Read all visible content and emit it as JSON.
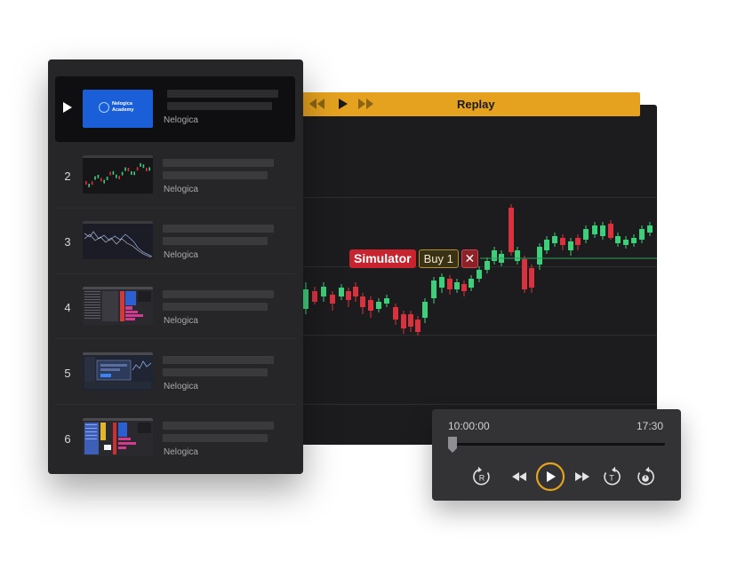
{
  "replay": {
    "title": "Replay",
    "icons": [
      "rewind-icon",
      "play-icon",
      "fast-forward-icon"
    ]
  },
  "simulator": {
    "label": "Simulator",
    "order": "Buy 1",
    "close_symbol": "✕"
  },
  "playlist": {
    "items": [
      {
        "number": "",
        "author": "Nelogica",
        "thumbnail": "academy",
        "logo_text_1": "Nelogica",
        "logo_text_2": "Academy",
        "active": true
      },
      {
        "number": "2",
        "author": "Nelogica",
        "thumbnail": "candles"
      },
      {
        "number": "3",
        "author": "Nelogica",
        "thumbnail": "lines"
      },
      {
        "number": "4",
        "author": "Nelogica",
        "thumbnail": "dom"
      },
      {
        "number": "5",
        "author": "Nelogica",
        "thumbnail": "window"
      },
      {
        "number": "6",
        "author": "Nelogica",
        "thumbnail": "dom2"
      }
    ]
  },
  "player": {
    "time_start": "10:00:00",
    "time_end": "17:30",
    "progress": 0,
    "controls": [
      "replay-r-icon",
      "rewind-icon",
      "play-icon",
      "fast-forward-icon",
      "replay-t-icon",
      "timer-icon"
    ]
  },
  "colors": {
    "accent": "#e5a21f",
    "up": "#3ecf7a",
    "down": "#d9323f",
    "panel": "#262628",
    "chart_bg": "#1c1c1e",
    "player_play_ring": "#e5a21f"
  }
}
